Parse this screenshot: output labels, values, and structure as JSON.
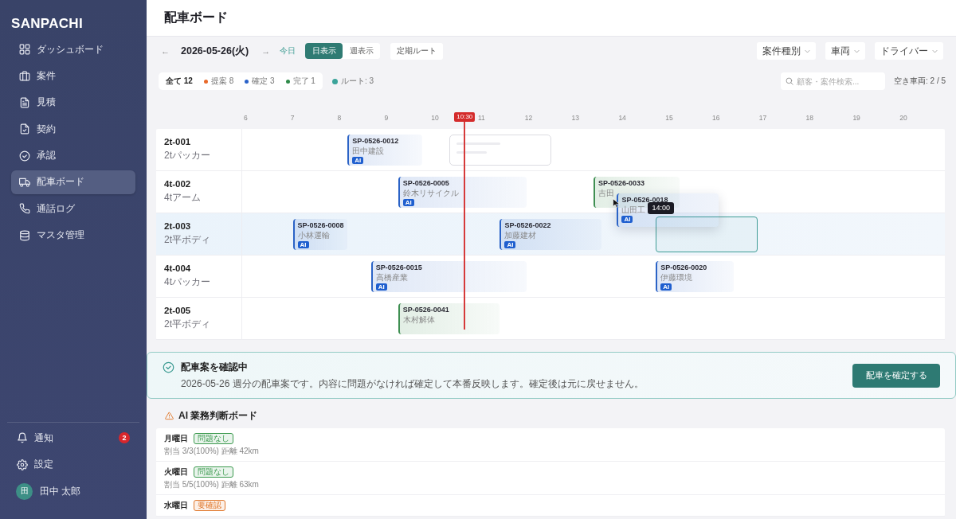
{
  "sidebar": {
    "logo": "SANPACHI",
    "items": [
      {
        "label": "ダッシュボード",
        "selected": false
      },
      {
        "label": "案件",
        "selected": false
      },
      {
        "label": "見積",
        "selected": false
      },
      {
        "label": "契約",
        "selected": false
      },
      {
        "label": "承認",
        "selected": false
      },
      {
        "label": "配車ボード",
        "selected": true
      },
      {
        "label": "通話ログ",
        "selected": false
      },
      {
        "label": "マスタ管理",
        "selected": false
      }
    ],
    "footer_items": [
      {
        "label": "通知",
        "badge": "2"
      },
      {
        "label": "設定"
      }
    ],
    "user": {
      "initial": "田",
      "name": "田中 太郎"
    }
  },
  "header": {
    "title": "配車ボード"
  },
  "toolbar": {
    "prev": "←",
    "date": "2026-05-26(火)",
    "next": "→",
    "today": "今日",
    "views": [
      {
        "label": "日表示",
        "selected": true
      },
      {
        "label": "週表示",
        "selected": false
      }
    ],
    "routes_button": "定期ルート",
    "dropdowns": [
      "案件種別",
      "車両",
      "ドライバー"
    ]
  },
  "filters": {
    "chips": [
      {
        "label": "全て 12",
        "selected": true
      },
      {
        "label": "提案 8",
        "color": "#e8692a",
        "selected": false
      },
      {
        "label": "確定 3",
        "color": "#2a62c9",
        "selected": false
      },
      {
        "label": "完了 1",
        "color": "#2f8a4a",
        "selected": false
      }
    ],
    "routes": {
      "label": "ルート: 3",
      "color": "#3aa39a"
    },
    "search": {
      "placeholder": "顧客・案件検索..."
    },
    "available": "空き車両: 2 / 5"
  },
  "timeline": {
    "hours": [
      "6",
      "7",
      "8",
      "9",
      "10",
      "11",
      "12",
      "13",
      "14",
      "15",
      "16",
      "17",
      "18",
      "19",
      "20"
    ],
    "now": "10:30",
    "rows": [
      {
        "vehicle": "2t-001",
        "type": "2tパッカー",
        "highlighted": false,
        "items": [
          {
            "kind": "booking",
            "id": "SP-0526-0012",
            "customer": "田中建設",
            "badge": "AI",
            "color": "#2b63c6"
          },
          {
            "kind": "placeholder"
          }
        ]
      },
      {
        "vehicle": "4t-002",
        "type": "4tアーム",
        "highlighted": false,
        "items": [
          {
            "kind": "booking",
            "id": "SP-0526-0005",
            "customer": "鈴木リサイクル",
            "badge": "AI",
            "color": "#2b63c6"
          },
          {
            "kind": "booking",
            "id": "SP-0526-0033",
            "customer": "吉田",
            "color": "#3f8f52"
          }
        ]
      },
      {
        "vehicle": "2t-003",
        "type": "2t平ボディ",
        "highlighted": true,
        "items": [
          {
            "kind": "booking",
            "id": "SP-0526-0008",
            "customer": "小林運輸",
            "badge": "AI",
            "color": "#2b63c6"
          },
          {
            "kind": "booking",
            "id": "SP-0526-0022",
            "customer": "加藤建材",
            "badge": "AI",
            "color": "#2b63c6"
          },
          {
            "kind": "drop_target"
          }
        ]
      },
      {
        "vehicle": "4t-004",
        "type": "4tパッカー",
        "highlighted": false,
        "items": [
          {
            "kind": "booking",
            "id": "SP-0526-0015",
            "customer": "高橋産業",
            "badge": "AI",
            "color": "#2b63c6"
          },
          {
            "kind": "booking",
            "id": "SP-0526-0020",
            "customer": "伊藤環境",
            "badge": "AI",
            "color": "#2b63c6"
          }
        ]
      },
      {
        "vehicle": "2t-005",
        "type": "2t平ボディ",
        "highlighted": false,
        "items": [
          {
            "kind": "booking",
            "id": "SP-0526-0041",
            "customer": "木村解体",
            "color": "#3f8f52"
          }
        ]
      }
    ],
    "dragging": {
      "id": "SP-0526-0018",
      "customer": "山田工",
      "badge": "AI",
      "color": "#2b63c6",
      "tooltip": "14:00"
    }
  },
  "confirm_banner": {
    "title": "配車案を確認中",
    "message": "2026-05-26 週分の配車案です。内容に問題がなければ確定して本番反映します。確定後は元に戻せません。",
    "button": "配車を確定する"
  },
  "ai_board": {
    "title": "AI 業務判断ボード",
    "days": [
      {
        "day": "月曜日",
        "status": "問題なし",
        "color": "#3b9a4e",
        "detail": "割当 3/3(100%) 距離 42km"
      },
      {
        "day": "火曜日",
        "status": "問題なし",
        "color": "#3b9a4e",
        "detail": "割当 5/5(100%) 距離 63km"
      },
      {
        "day": "水曜日",
        "status": "要確認",
        "color": "#e0772b"
      }
    ]
  }
}
